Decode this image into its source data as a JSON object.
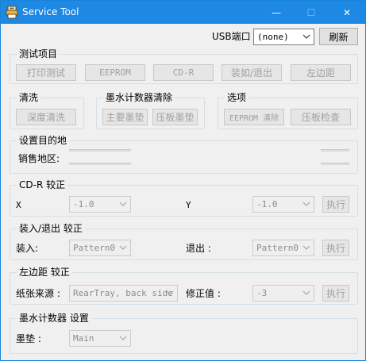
{
  "window": {
    "title": "Service Tool",
    "controls": {
      "minimize": "—",
      "maximize": "☐",
      "close": "✕"
    }
  },
  "usb": {
    "label": "USB端口",
    "selected": "(none)",
    "refresh_label": "刷新"
  },
  "test_items": {
    "title": "测试项目",
    "buttons": [
      "打印测试",
      "EEPROM",
      "CD-R",
      "装如/退出",
      "左边距"
    ]
  },
  "cleaning": {
    "title": "清洗",
    "deep_clean": "深度清洗"
  },
  "ink_counter_clear": {
    "title": "墨水计数器清除",
    "main_pad": "主要墨垫",
    "platen_pad": "压板墨垫"
  },
  "options": {
    "title": "选项",
    "eeprom_clear": "EEPROM 清除",
    "platen_check": "压板检查"
  },
  "destination": {
    "title": "设置目的地",
    "region_label": "销售地区:"
  },
  "cdr_adjust": {
    "title": "CD-R 较正",
    "x_label": "X",
    "x_value": "-1.0",
    "y_label": "Y",
    "y_value": "-1.0",
    "execute": "执行"
  },
  "load_eject_adjust": {
    "title": "装入/退出 较正",
    "load_label": "装入:",
    "load_value": "Pattern0",
    "eject_label": "退出 :",
    "eject_value": "Pattern0",
    "execute": "执行"
  },
  "left_margin_adjust": {
    "title": "左边距 较正",
    "source_label": "纸张来源 :",
    "source_value": "RearTray, back side",
    "correction_label": "修正值 :",
    "correction_value": "-3",
    "execute": "执行"
  },
  "ink_counter_settings": {
    "title": "墨水计数器 设置",
    "pad_label": "墨垫 :",
    "pad_value": "Main"
  },
  "icons": {
    "app": "printer-app-icon",
    "dropdown": "chevron-down-icon"
  },
  "colors": {
    "titlebar": "#1e88e5",
    "window_bg": "#f0f0f0",
    "disabled_text": "#a0a0a0"
  }
}
